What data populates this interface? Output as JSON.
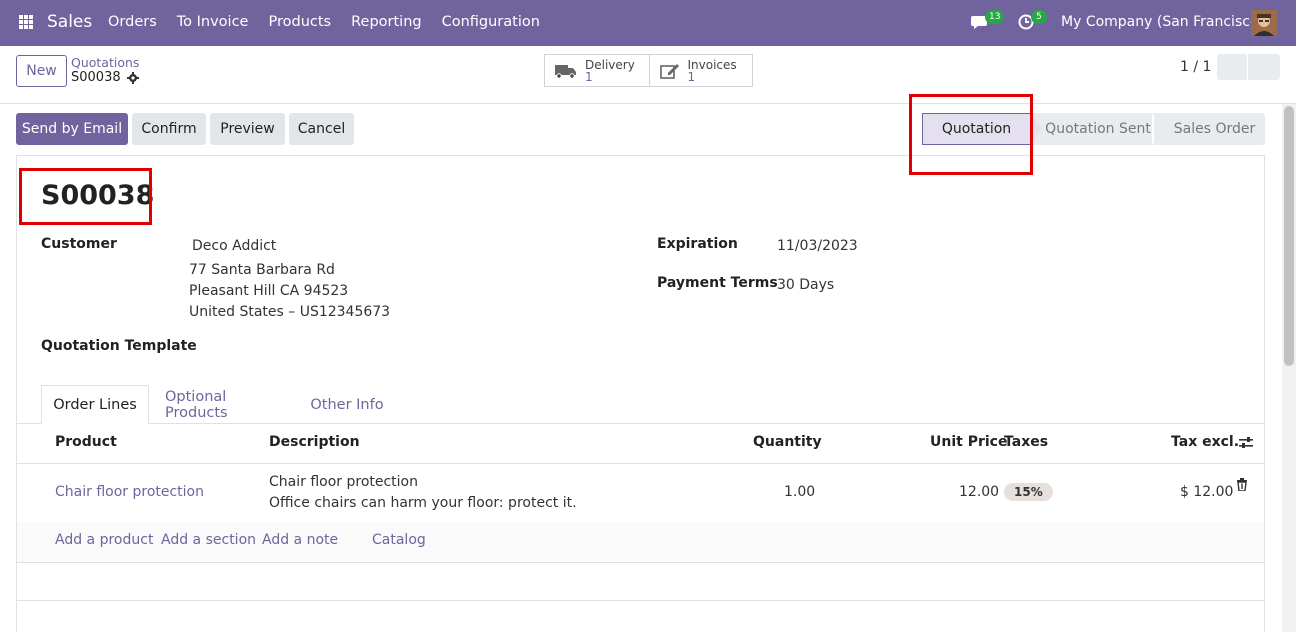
{
  "navbar": {
    "app_name": "Sales",
    "menu": [
      "Orders",
      "To Invoice",
      "Products",
      "Reporting",
      "Configuration"
    ],
    "messages_count": "13",
    "activities_count": "5",
    "company": "My Company (San Francisco)"
  },
  "control_panel": {
    "new_label": "New",
    "breadcrumb_parent": "Quotations",
    "breadcrumb_current": "S00038",
    "smart_buttons": [
      {
        "label": "Delivery",
        "count": "1",
        "icon": "truck-icon"
      },
      {
        "label": "Invoices",
        "count": "1",
        "icon": "edit-icon"
      }
    ],
    "pager": "1 / 1"
  },
  "actions": {
    "send_email": "Send by Email",
    "confirm": "Confirm",
    "preview": "Preview",
    "cancel": "Cancel"
  },
  "status": {
    "stages": [
      "Quotation",
      "Quotation Sent",
      "Sales Order"
    ],
    "current": "Quotation"
  },
  "form": {
    "name": "S00038",
    "customer_label": "Customer",
    "customer_name": "Deco Addict",
    "address": [
      "77 Santa Barbara Rd",
      "Pleasant Hill CA 94523",
      "United States – US12345673"
    ],
    "expiration_label": "Expiration",
    "expiration_value": "11/03/2023",
    "payment_terms_label": "Payment Terms",
    "payment_terms_value": "30 Days",
    "template_label": "Quotation Template"
  },
  "tabs": [
    "Order Lines",
    "Optional Products",
    "Other Info"
  ],
  "order_lines": {
    "headers": {
      "product": "Product",
      "description": "Description",
      "quantity": "Quantity",
      "unit_price": "Unit Price",
      "taxes": "Taxes",
      "subtotal": "Tax excl."
    },
    "rows": [
      {
        "product": "Chair floor protection",
        "description_1": "Chair floor protection",
        "description_2": "Office chairs can harm your floor: protect it.",
        "quantity": "1.00",
        "unit_price": "12.00",
        "taxes": "15%",
        "subtotal": "$ 12.00"
      }
    ],
    "footer_links": [
      "Add a product",
      "Add a section",
      "Add a note",
      "Catalog"
    ]
  },
  "colors": {
    "brand": "#71639e",
    "highlight": "#e00000"
  }
}
